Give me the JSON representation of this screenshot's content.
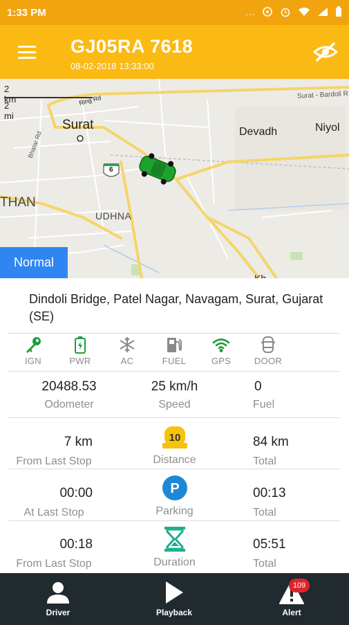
{
  "status_bar": {
    "time": "1:33 PM"
  },
  "header": {
    "title": "GJ05RA 7618",
    "datetime": "08-02-2018 13:33:00"
  },
  "map": {
    "scale_km": "2 km",
    "scale_mi": "2 mi",
    "labels": {
      "surat": "Surat",
      "devadh": "Devadh",
      "niyol": "Niyol",
      "udhna": "UDHNA",
      "than": "THAN",
      "ring_rd": "Ring Rd",
      "bhatar_rd": "Bhatar Rd",
      "bardoli_road": "Surat - Bardoli R",
      "highway": "6",
      "kh": "Kh"
    },
    "mode": "Normal"
  },
  "address": "Dindoli Bridge, Patel Nagar, Navagam, Surat, Gujarat (SE)",
  "sensors": [
    {
      "label": "IGN",
      "icon": "key-icon",
      "color": "#1F9D3A"
    },
    {
      "label": "PWR",
      "icon": "battery-icon",
      "color": "#1F9D3A"
    },
    {
      "label": "AC",
      "icon": "snowflake-icon",
      "color": "#8A8A8A"
    },
    {
      "label": "FUEL",
      "icon": "fuel-pump-icon",
      "color": "#8A8A8A"
    },
    {
      "label": "GPS",
      "icon": "wifi-signal-icon",
      "color": "#1F9D3A"
    },
    {
      "label": "DOOR",
      "icon": "car-door-icon",
      "color": "#8A8A8A"
    }
  ],
  "stats": {
    "odometer": {
      "value": "20488.53",
      "label": "Odometer"
    },
    "speed": {
      "value": "25 km/h",
      "label": "Speed"
    },
    "fuel": {
      "value": "0",
      "label": "Fuel"
    },
    "distance": {
      "left_value": "7 km",
      "left_label": "From Last Stop",
      "center_label": "Distance",
      "badge": "10",
      "right_value": "84 km",
      "right_label": "Total"
    },
    "parking": {
      "left_value": "00:00",
      "left_label": "At Last Stop",
      "center_label": "Parking",
      "badge": "P",
      "right_value": "00:13",
      "right_label": "Total"
    },
    "duration": {
      "left_value": "00:18",
      "left_label": "From Last Stop",
      "center_label": "Duration",
      "right_value": "05:51",
      "right_label": "Total"
    }
  },
  "bottom_nav": {
    "driver": "Driver",
    "playback": "Playback",
    "alert": "Alert",
    "alert_count": "109"
  },
  "colors": {
    "status_bar": "#F2A40F",
    "app_bar": "#FBB913",
    "mode_chip": "#2F86F0",
    "bottom_nav": "#212A2E",
    "active_green": "#1F9D3A"
  }
}
